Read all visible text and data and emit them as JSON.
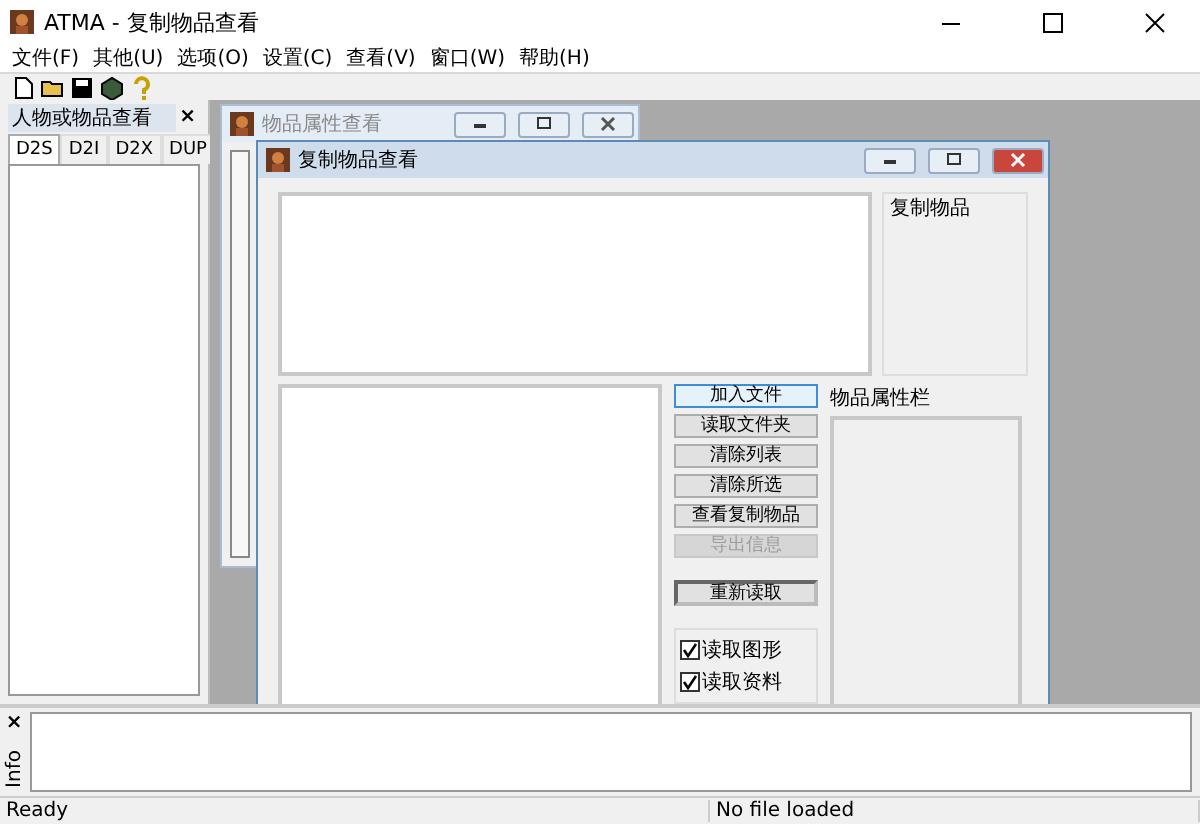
{
  "window": {
    "title": "ATMA - 复制物品查看"
  },
  "menu": [
    {
      "label": "文件(F)"
    },
    {
      "label": "其他(U)"
    },
    {
      "label": "选项(O)"
    },
    {
      "label": "设置(C)"
    },
    {
      "label": "查看(V)"
    },
    {
      "label": "窗口(W)"
    },
    {
      "label": "帮助(H)"
    }
  ],
  "left_panel": {
    "title": "人物或物品查看",
    "close": "×",
    "tabs": [
      {
        "label": "D2S",
        "selected": true
      },
      {
        "label": "D2I",
        "selected": false
      },
      {
        "label": "D2X",
        "selected": false
      },
      {
        "label": "DUP",
        "selected": false
      }
    ]
  },
  "back_window": {
    "title": "物品属性查看",
    "active": false
  },
  "front_window": {
    "title": "复制物品查看",
    "active": true,
    "list_label": "复制物品",
    "properties_label": "物品属性栏",
    "buttons": [
      {
        "label": "加入文件",
        "disabled": false,
        "focused": true
      },
      {
        "label": "读取文件夹",
        "disabled": false,
        "focused": false
      },
      {
        "label": "清除列表",
        "disabled": false,
        "focused": false
      },
      {
        "label": "清除所选",
        "disabled": false,
        "focused": false
      },
      {
        "label": "查看复制物品",
        "disabled": false,
        "focused": false
      },
      {
        "label": "导出信息",
        "disabled": true,
        "focused": false
      }
    ],
    "reload_button": "重新读取",
    "checkboxes": [
      {
        "label": "读取图形",
        "checked": true
      },
      {
        "label": "读取资料",
        "checked": true
      }
    ]
  },
  "info_panel": {
    "close": "×",
    "label": "Info"
  },
  "status_bar": [
    "Ready",
    "No file loaded"
  ]
}
